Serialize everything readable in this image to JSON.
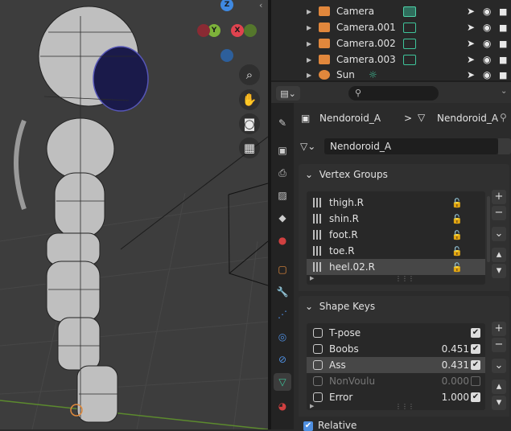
{
  "viewport": {
    "axes": {
      "z": "Z",
      "y": "Y",
      "x": "X"
    },
    "tools": [
      "zoom-icon",
      "hand-icon",
      "camera-view-icon",
      "grid-icon"
    ],
    "colors": {
      "background": "#3d3d3d",
      "x_axis": "#e0434f",
      "y_axis": "#7db33a",
      "z_axis": "#3f89e1"
    }
  },
  "outliner": {
    "rows": [
      {
        "label": "Camera",
        "selected_data": true
      },
      {
        "label": "Camera.001",
        "selected_data": false
      },
      {
        "label": "Camera.002",
        "selected_data": false
      },
      {
        "label": "Camera.003",
        "selected_data": false
      },
      {
        "label": "Sun",
        "selected_data": false
      }
    ]
  },
  "properties": {
    "search_placeholder": "",
    "breadcrumb": {
      "object": "Nendoroid_A",
      "separator": ">",
      "mesh": "Nendoroid_A"
    },
    "mesh_name": "Nendoroid_A",
    "vertex_groups": {
      "title": "Vertex Groups",
      "items": [
        "thigh.R",
        "shin.R",
        "foot.R",
        "toe.R",
        "heel.02.R"
      ],
      "selected_index": 4
    },
    "shape_keys": {
      "title": "Shape Keys",
      "items": [
        {
          "name": "T-pose",
          "value": "",
          "checked": true,
          "muted": false
        },
        {
          "name": "Boobs",
          "value": "0.451",
          "checked": true,
          "muted": false
        },
        {
          "name": "Ass",
          "value": "0.431",
          "checked": true,
          "muted": false
        },
        {
          "name": "NonVoulu",
          "value": "0.000",
          "checked": false,
          "muted": true
        },
        {
          "name": "Error",
          "value": "1.000",
          "checked": true,
          "muted": false
        }
      ],
      "selected_index": 2
    },
    "relative_label": "Relative"
  }
}
